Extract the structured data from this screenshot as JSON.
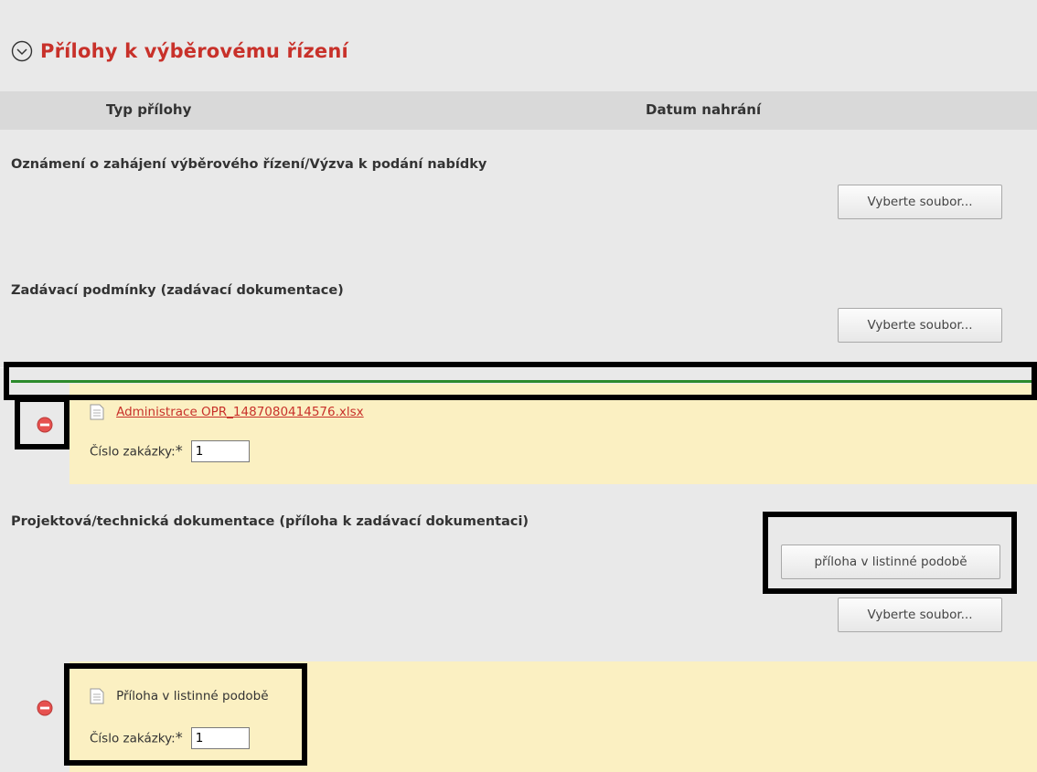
{
  "section": {
    "title": "Přílohy k výběrovému řízení",
    "icon": "chevron-circle-down-icon"
  },
  "table_header": {
    "col_type": "Typ přílohy",
    "col_date": "Datum nahrání"
  },
  "rows": [
    {
      "label": "Oznámení o zahájení výběrového řízení/Výzva k podání nabídky",
      "select_button": "Vyberte soubor..."
    },
    {
      "label": "Zadávací podmínky (zadávací dokumentace)",
      "select_button": "Vyberte soubor..."
    },
    {
      "label": "Projektová/technická dokumentace (příloha k zadávací dokumentaci)",
      "paper_button": "příloha v listinné podobě",
      "select_button": "Vyberte soubor..."
    }
  ],
  "files": [
    {
      "name": "Administrace OPR_1487080414576.xlsx",
      "order_label": "Číslo zakázky:",
      "required_mark": "*",
      "order_value": "1"
    },
    {
      "name": "Příloha v listinné podobě",
      "order_label": "Číslo zakázky:",
      "required_mark": "*",
      "order_value": "1"
    }
  ],
  "colors": {
    "title_red": "#c8312a",
    "file_bg": "#fbf0c2",
    "panel_bg": "#e9e9e9",
    "header_bg": "#d9d9d9",
    "annotation": "#000000",
    "divider_green": "#2c8a2c"
  }
}
